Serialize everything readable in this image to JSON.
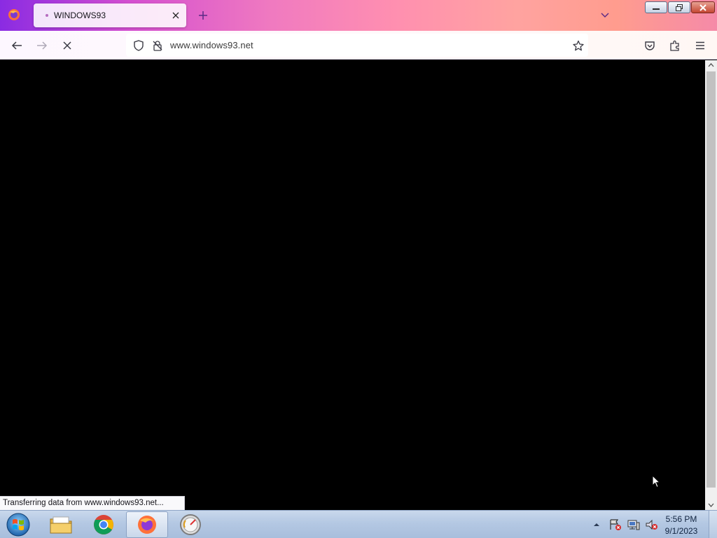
{
  "browser": {
    "tab": {
      "title": "WINDOWS93"
    },
    "url": "www.windows93.net",
    "status_text": "Transferring data from www.windows93.net...",
    "icons": {
      "app": "firefox-logo",
      "new_tab": "plus-icon",
      "tab_list": "chevron-down-icon",
      "back": "arrow-left-icon",
      "forward": "arrow-right-icon",
      "stop": "close-icon",
      "tracking_protection": "shield-icon",
      "connection": "lock-strike-icon",
      "bookmark": "star-icon",
      "pocket": "pocket-icon",
      "extensions": "puzzle-icon",
      "menu": "hamburger-icon"
    }
  },
  "window_controls": [
    "minimize",
    "restore",
    "close"
  ],
  "taskbar": {
    "pinned": [
      "file-explorer-icon",
      "chrome-icon",
      "firefox-icon",
      "speedometer-icon"
    ],
    "active": "firefox-icon",
    "tray": [
      "tray-expand-icon",
      "action-center-flag-icon",
      "network-icon",
      "volume-muted-icon"
    ],
    "clock": {
      "time": "5:56 PM",
      "date": "9/1/2023"
    }
  },
  "colors": {
    "tabstrip_accent": "#d44fd0",
    "content_bg": "#000000",
    "taskbar": "#b4c8e3"
  }
}
